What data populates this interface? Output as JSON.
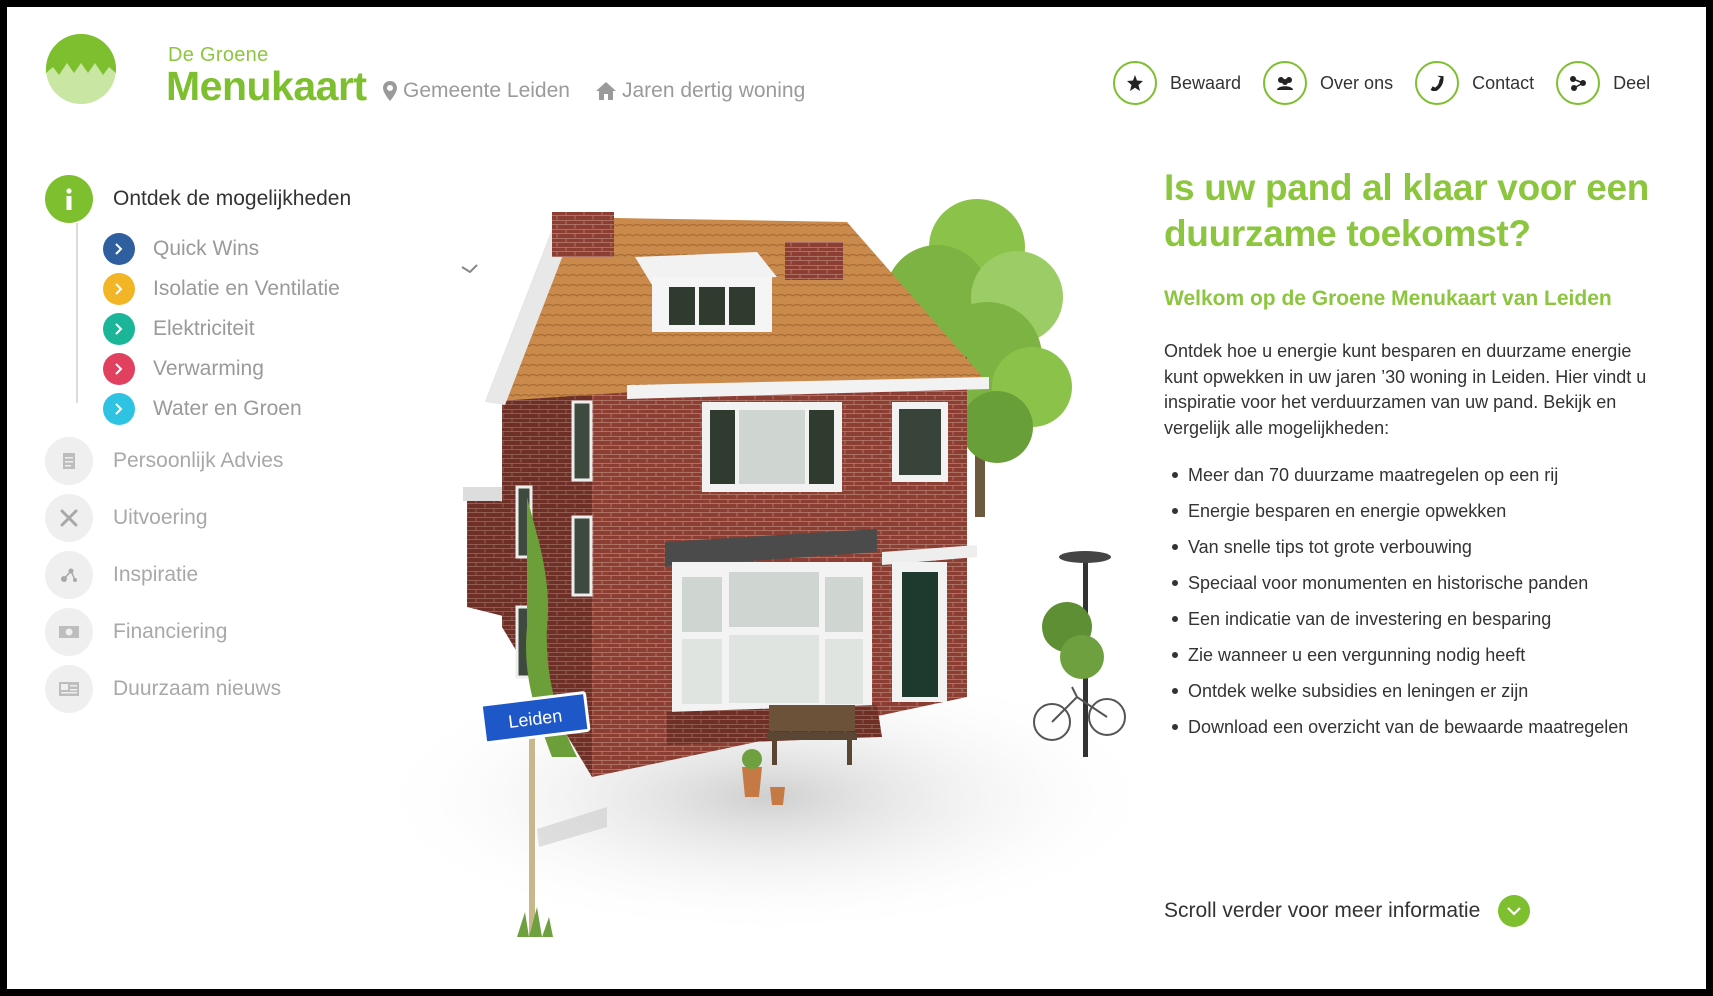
{
  "brand": {
    "line1": "De Groene",
    "line2": "Menukaart",
    "color": "#7dbf2e"
  },
  "breadcrumbs": [
    {
      "icon": "location-pin-icon",
      "label": "Gemeente Leiden"
    },
    {
      "icon": "home-icon",
      "label": "Jaren dertig woning"
    }
  ],
  "topnav": [
    {
      "icon": "star-icon",
      "label": "Bewaard"
    },
    {
      "icon": "users-icon",
      "label": "Over ons"
    },
    {
      "icon": "phone-icon",
      "label": "Contact"
    },
    {
      "icon": "share-icon",
      "label": "Deel"
    }
  ],
  "sidebar": {
    "active": {
      "icon": "info-icon",
      "label": "Ontdek de mogelijkheden"
    },
    "subitems": [
      {
        "label": "Quick Wins",
        "color": "#2f5f9e"
      },
      {
        "label": "Isolatie en Ventilatie",
        "color": "#f2b526"
      },
      {
        "label": "Elektriciteit",
        "color": "#1bb69a"
      },
      {
        "label": "Verwarming",
        "color": "#e2405f"
      },
      {
        "label": "Water en Groen",
        "color": "#2ec3e3"
      }
    ],
    "items": [
      {
        "icon": "document-icon",
        "label": "Persoonlijk Advies"
      },
      {
        "icon": "tools-icon",
        "label": "Uitvoering"
      },
      {
        "icon": "inspiration-icon",
        "label": "Inspiratie"
      },
      {
        "icon": "money-icon",
        "label": "Financiering"
      },
      {
        "icon": "newspaper-icon",
        "label": "Duurzaam nieuws"
      }
    ]
  },
  "illustration": {
    "sign_text": "Leiden"
  },
  "content": {
    "headline": "Is uw pand al klaar voor een duurzame toekomst?",
    "subhead": "Welkom op de Groene Menukaart van Leiden",
    "intro": "Ontdek hoe u energie kunt besparen en duurzame energie kunt opwekken in uw jaren ’30 woning in Leiden. Hier vindt u inspiratie voor het verduurzamen van uw pand. Bekijk en vergelijk alle mogelijkheden:",
    "bullets": [
      "Meer dan 70 duurzame maatregelen op een rij",
      "Energie besparen en energie opwekken",
      "Van snelle tips tot grote verbouwing",
      "Speciaal voor monumenten en historische panden",
      "Een indicatie van de investering en besparing",
      "Zie wanneer u een vergunning nodig heeft",
      "Ontdek welke subsidies en leningen er zijn",
      "Download een overzicht van de bewaarde maatregelen"
    ],
    "scroll_label": "Scroll verder voor meer informatie"
  }
}
